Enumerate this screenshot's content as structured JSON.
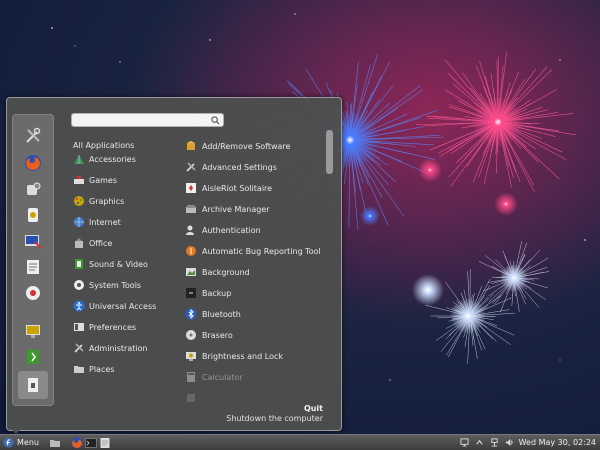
{
  "search": {
    "value": "",
    "placeholder": ""
  },
  "favorites": [
    {
      "name": "tools-icon"
    },
    {
      "name": "firefox-icon"
    },
    {
      "name": "settings-icon"
    },
    {
      "name": "media-icon"
    },
    {
      "name": "terminal-icon"
    },
    {
      "name": "text-editor-icon"
    },
    {
      "name": "help-icon"
    },
    {
      "name": "display-icon"
    },
    {
      "name": "logout-icon"
    },
    {
      "name": "shutdown-icon"
    }
  ],
  "categories": [
    {
      "label": "All Applications",
      "icon": ""
    },
    {
      "label": "Accessories",
      "icon": "accessories-icon"
    },
    {
      "label": "Games",
      "icon": "games-icon"
    },
    {
      "label": "Graphics",
      "icon": "graphics-icon"
    },
    {
      "label": "Internet",
      "icon": "internet-icon"
    },
    {
      "label": "Office",
      "icon": "office-icon"
    },
    {
      "label": "Sound & Video",
      "icon": "sound-video-icon"
    },
    {
      "label": "System Tools",
      "icon": "system-tools-icon"
    },
    {
      "label": "Universal Access",
      "icon": "universal-access-icon"
    },
    {
      "label": "Preferences",
      "icon": "preferences-icon"
    },
    {
      "label": "Administration",
      "icon": "administration-icon"
    },
    {
      "label": "Places",
      "icon": "places-icon"
    }
  ],
  "apps": [
    {
      "label": "Add/Remove Software",
      "icon": "package-icon"
    },
    {
      "label": "Advanced Settings",
      "icon": "tools-icon"
    },
    {
      "label": "AisleRiot Solitaire",
      "icon": "cards-icon"
    },
    {
      "label": "Archive Manager",
      "icon": "archive-icon"
    },
    {
      "label": "Authentication",
      "icon": "users-icon"
    },
    {
      "label": "Automatic Bug Reporting Tool",
      "icon": "bug-icon"
    },
    {
      "label": "Background",
      "icon": "background-icon"
    },
    {
      "label": "Backup",
      "icon": "backup-icon"
    },
    {
      "label": "Bluetooth",
      "icon": "bluetooth-icon"
    },
    {
      "label": "Brasero",
      "icon": "disc-icon"
    },
    {
      "label": "Brightness and Lock",
      "icon": "brightness-icon"
    },
    {
      "label": "Calculator",
      "icon": "calculator-icon"
    },
    {
      "label": "",
      "icon": "app-icon"
    }
  ],
  "quit": {
    "title": "Quit",
    "description": "Shutdown the computer"
  },
  "panel": {
    "menu_label": "Menu",
    "clock": "Wed May 30, 02:24"
  },
  "colors": {
    "menu_bg": "#4e4e4e",
    "panel_bg": "#4a4a4a",
    "text": "#e8e8e8"
  }
}
